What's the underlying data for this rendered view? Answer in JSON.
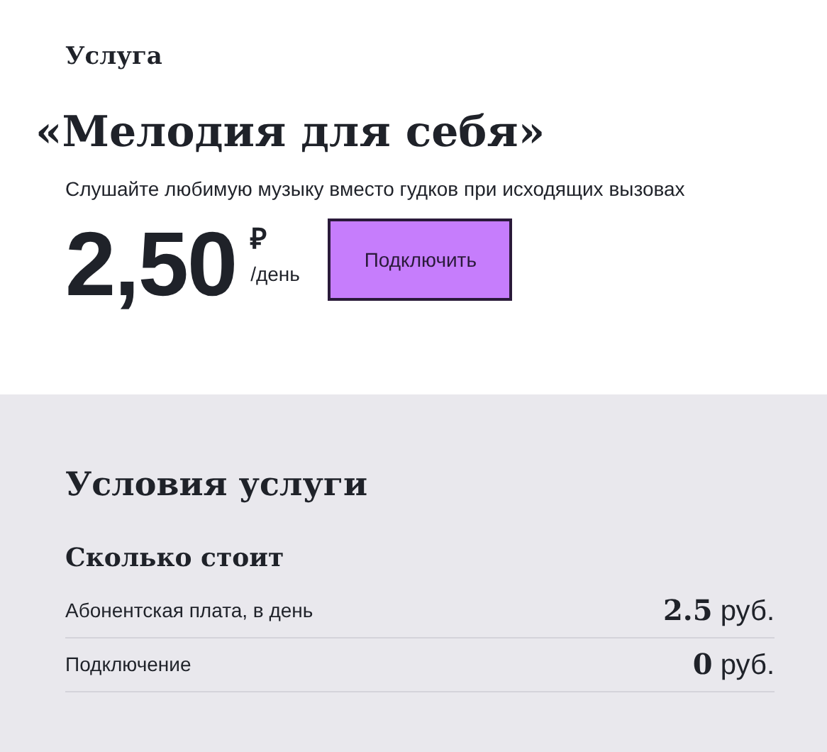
{
  "service": {
    "label": "Услуга",
    "title": "«Мелодия для себя»",
    "description": "Слушайте любимую музыку вместо гудков при исходящих вызовах",
    "price": {
      "amount": "2,50",
      "currency": "₽",
      "period": "/день"
    },
    "button": "Подключить"
  },
  "conditions": {
    "title": "Условия услуги",
    "subtitle": "Сколько стоит",
    "rows": [
      {
        "label": "Абонентская плата, в день",
        "amount": "2.5",
        "unit": "руб."
      },
      {
        "label": "Подключение",
        "amount": "0",
        "unit": "руб."
      }
    ]
  }
}
